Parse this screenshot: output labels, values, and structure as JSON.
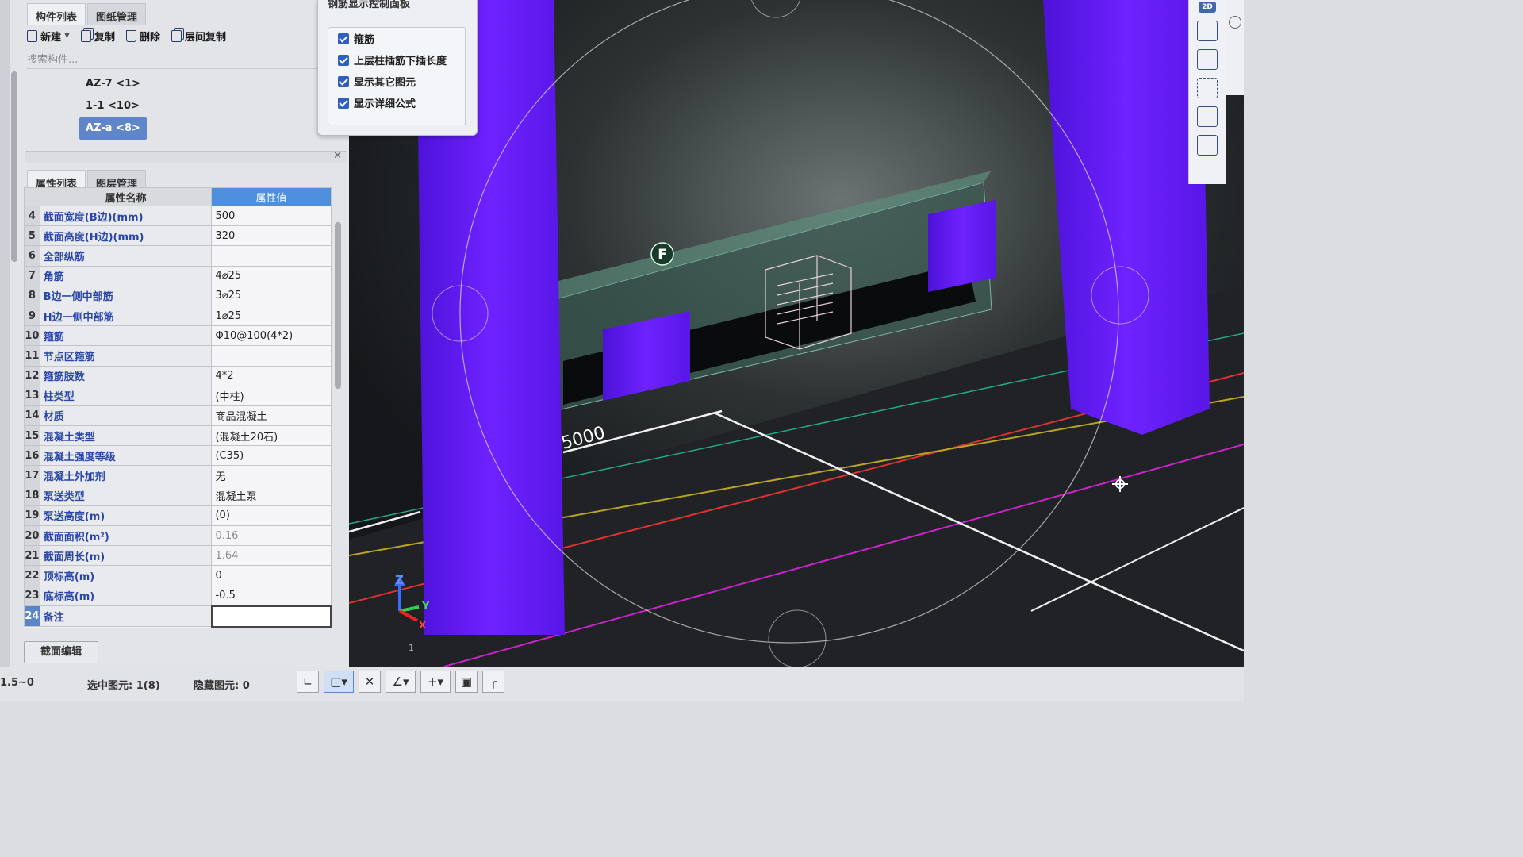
{
  "component_panel": {
    "tabs": [
      "构件列表",
      "图纸管理"
    ],
    "toolbar": {
      "new": "新建",
      "copy": "复制",
      "delete": "删除",
      "floor_copy": "层间复制"
    },
    "search_placeholder": "搜索构件...",
    "items": [
      {
        "label": "AZ-7 <1>"
      },
      {
        "label": "1-1 <10>"
      },
      {
        "label": "AZ-a <8>"
      }
    ]
  },
  "property_panel": {
    "tabs": [
      "属性列表",
      "图层管理"
    ],
    "headers": {
      "name": "属性名称",
      "value": "属性值"
    },
    "rows": [
      {
        "no": "4",
        "name": "截面宽度(B边)(mm)",
        "value": "500"
      },
      {
        "no": "5",
        "name": "截面高度(H边)(mm)",
        "value": "320"
      },
      {
        "no": "6",
        "name": "全部纵筋",
        "value": ""
      },
      {
        "no": "7",
        "name": "角筋",
        "value": "4⌀25"
      },
      {
        "no": "8",
        "name": "B边一侧中部筋",
        "value": "3⌀25"
      },
      {
        "no": "9",
        "name": "H边一侧中部筋",
        "value": "1⌀25"
      },
      {
        "no": "10",
        "name": "箍筋",
        "value": "Φ10@100(4*2)"
      },
      {
        "no": "11",
        "name": "节点区箍筋",
        "value": ""
      },
      {
        "no": "12",
        "name": "箍筋肢数",
        "value": "4*2"
      },
      {
        "no": "13",
        "name": "柱类型",
        "value": "(中柱)"
      },
      {
        "no": "14",
        "name": "材质",
        "value": "商品混凝土"
      },
      {
        "no": "15",
        "name": "混凝土类型",
        "value": "(混凝土20石)"
      },
      {
        "no": "16",
        "name": "混凝土强度等级",
        "value": "(C35)"
      },
      {
        "no": "17",
        "name": "混凝土外加剂",
        "value": "无"
      },
      {
        "no": "18",
        "name": "泵送类型",
        "value": "混凝土泵"
      },
      {
        "no": "19",
        "name": "泵送高度(m)",
        "value": "(0)"
      },
      {
        "no": "20",
        "name": "截面面积(m²)",
        "value": "0.16"
      },
      {
        "no": "21",
        "name": "截面周长(m)",
        "value": "1.64"
      },
      {
        "no": "22",
        "name": "顶标高(m)",
        "value": "0"
      },
      {
        "no": "23",
        "name": "底标高(m)",
        "value": "-0.5"
      },
      {
        "no": "24",
        "name": "备注",
        "value": ""
      }
    ],
    "section_edit_button": "截面编辑"
  },
  "rebar_panel": {
    "title": "钢筋显示控制面板",
    "options": [
      {
        "label": "箍筋",
        "checked": true
      },
      {
        "label": "上层柱插筋下插长度",
        "checked": true
      },
      {
        "label": "显示其它图元",
        "checked": true
      },
      {
        "label": "显示详细公式",
        "checked": true
      }
    ]
  },
  "viewport": {
    "axis_label_f": "F",
    "dimension_label": "5000",
    "axis_z": "Z",
    "axis_y": "Y",
    "axis_x": "X",
    "grid_tick": "1",
    "view_mode": "2D",
    "colors": {
      "column": "#6a1cf5",
      "background": "#1a1c20"
    }
  },
  "status_bar": {
    "range": "1.5~0",
    "selected": "选中图元: 1(8)",
    "hidden": "隐藏图元: 0"
  }
}
